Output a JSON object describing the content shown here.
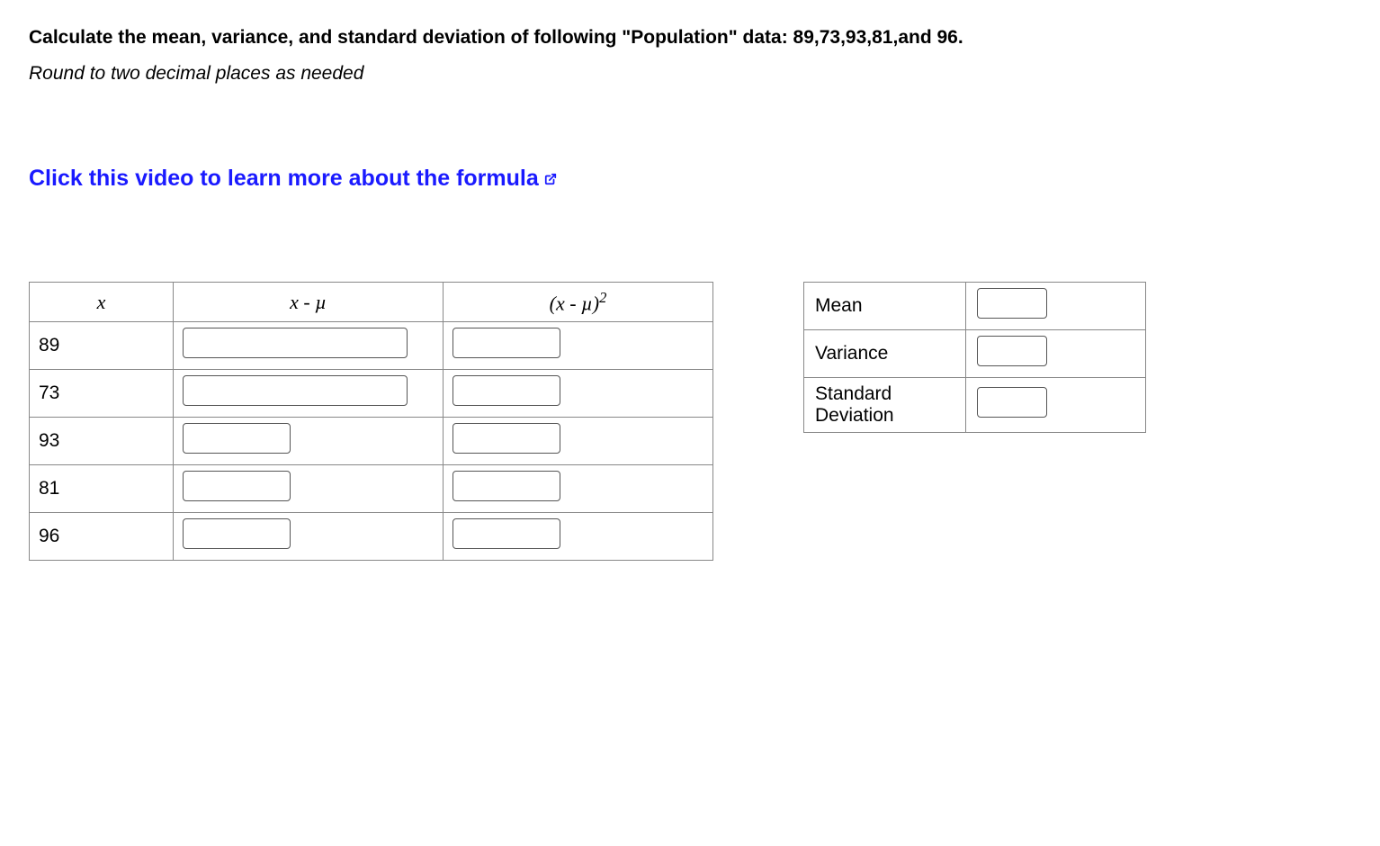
{
  "question": "Calculate the mean, variance, and standard deviation of following \"Population\" data: 89,73,93,81,and 96.",
  "instruction": "Round to two decimal places as needed",
  "video_link_text": "Click this video to learn more about the formula",
  "data_table": {
    "headers": {
      "x": "x",
      "xmu": "x - µ",
      "xmu2_prefix": "(x - µ)",
      "xmu2_exp": "2"
    },
    "rows": [
      {
        "x": "89"
      },
      {
        "x": "73"
      },
      {
        "x": "93"
      },
      {
        "x": "81"
      },
      {
        "x": "96"
      }
    ]
  },
  "results_table": {
    "rows": [
      {
        "label": "Mean"
      },
      {
        "label": "Variance"
      },
      {
        "label": "Standard Deviation"
      }
    ]
  }
}
